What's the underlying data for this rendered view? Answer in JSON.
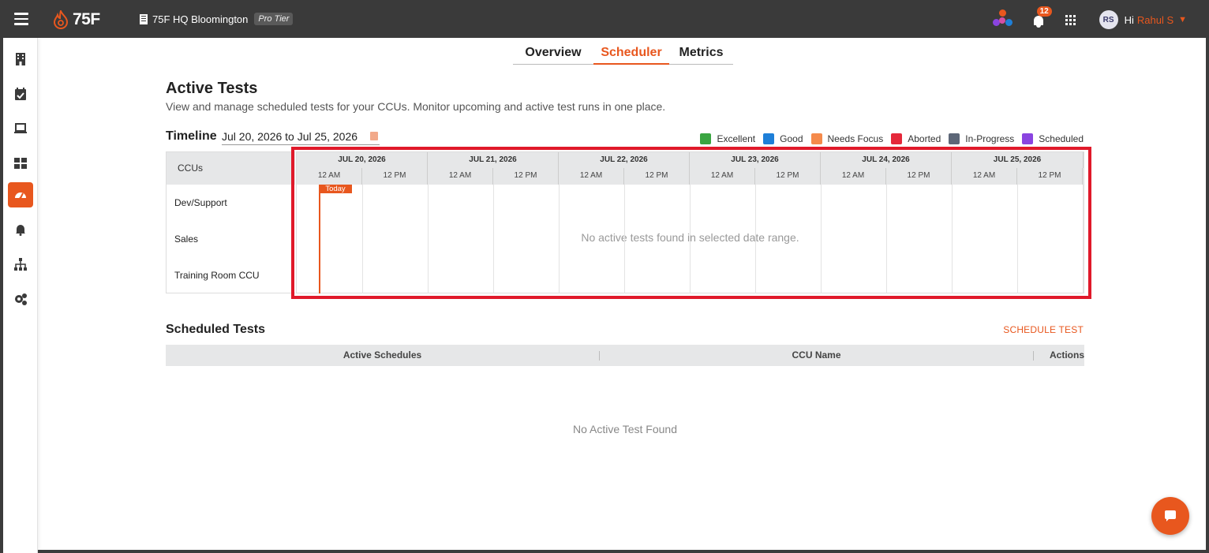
{
  "topbar": {
    "brand": "75F",
    "building_name": "75F HQ Bloomington",
    "tier": "Pro Tier",
    "notification_count": "12",
    "user_initials": "RS",
    "greeting": "Hi",
    "user_name": "Rahul S",
    "accent_color": "#e8571e"
  },
  "sidebar": {
    "items": [
      {
        "icon": "building-icon"
      },
      {
        "icon": "calendar-check-icon"
      },
      {
        "icon": "laptop-icon"
      },
      {
        "icon": "dashboard-grid-icon"
      },
      {
        "icon": "speedometer-icon",
        "active": true
      },
      {
        "icon": "bell-icon"
      },
      {
        "icon": "hierarchy-icon"
      },
      {
        "icon": "gears-icon"
      }
    ]
  },
  "tabs": [
    "Overview",
    "Scheduler",
    "Metrics"
  ],
  "page": {
    "title": "Active Tests",
    "subtitle": "View and manage scheduled tests for your CCUs. Monitor upcoming and active test runs in one place."
  },
  "timeline": {
    "label": "Timeline",
    "date_range": "Jul 20, 2026 to Jul 25, 2026",
    "legend": [
      {
        "label": "Excellent",
        "color": "#3aa541"
      },
      {
        "label": "Good",
        "color": "#1e7fd8"
      },
      {
        "label": "Needs Focus",
        "color": "#f58a4b"
      },
      {
        "label": "Aborted",
        "color": "#e5283a"
      },
      {
        "label": "In-Progress",
        "color": "#5d6778"
      },
      {
        "label": "Scheduled",
        "color": "#8a44e0"
      }
    ],
    "ccu_header": "CCUs",
    "ccus": [
      "Dev/Support",
      "Sales",
      "Training Room CCU"
    ],
    "days": [
      "JUL 20, 2026",
      "JUL 21, 2026",
      "JUL 22, 2026",
      "JUL 23, 2026",
      "JUL 24, 2026",
      "JUL 25, 2026"
    ],
    "half_labels": [
      "12 AM",
      "12 PM"
    ],
    "today_label": "Today",
    "empty_message": "No active tests found in selected date range."
  },
  "scheduled": {
    "title": "Scheduled Tests",
    "action": "SCHEDULE TEST",
    "columns": [
      "Active Schedules",
      "CCU Name",
      "Actions"
    ],
    "empty_message": "No Active Test Found"
  }
}
